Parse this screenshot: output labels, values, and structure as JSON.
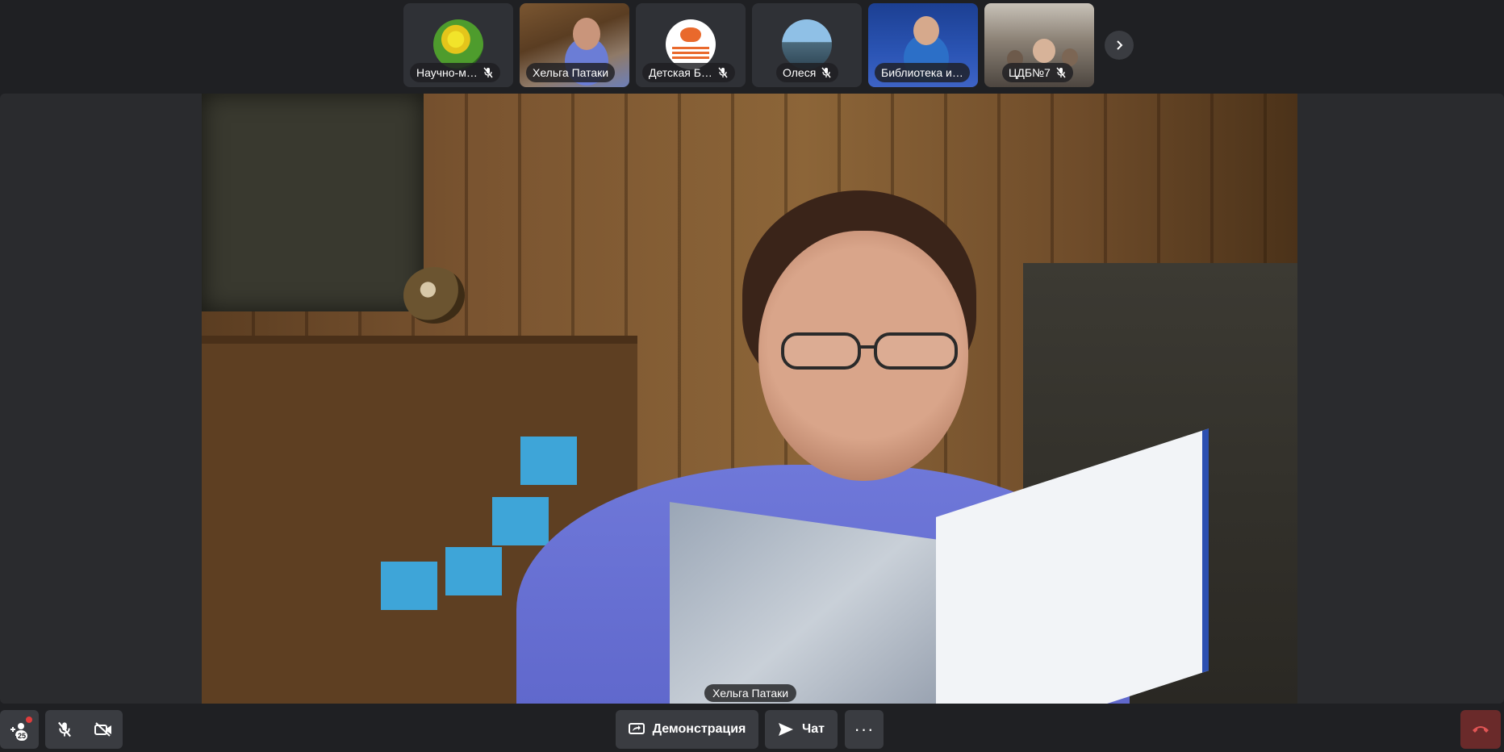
{
  "participants": [
    {
      "name": "Научно-м…",
      "avatar": "flower-avatar",
      "muted": true
    },
    {
      "name": "Хельга Патаки",
      "avatar": "video",
      "muted": false
    },
    {
      "name": "Детская Б…",
      "avatar": "library-logo-avatar",
      "muted": true
    },
    {
      "name": "Олеся",
      "avatar": "mountain-avatar",
      "muted": true
    },
    {
      "name": "Библиотека и…",
      "avatar": "video",
      "muted": false
    },
    {
      "name": "ЦДБ№7",
      "avatar": "video",
      "muted": true
    }
  ],
  "strip_next_icon": "chevron-right-icon",
  "main": {
    "speaker_name": "Хельга Патаки"
  },
  "toolbar": {
    "participant_count": "25",
    "demo_label": "Демонстрация",
    "chat_label": "Чат",
    "more_label": "···"
  },
  "colors": {
    "background": "#1f2023",
    "button": "#3a3c41",
    "hangup": "#6a2a2a",
    "badge_dot": "#e03c3c"
  }
}
